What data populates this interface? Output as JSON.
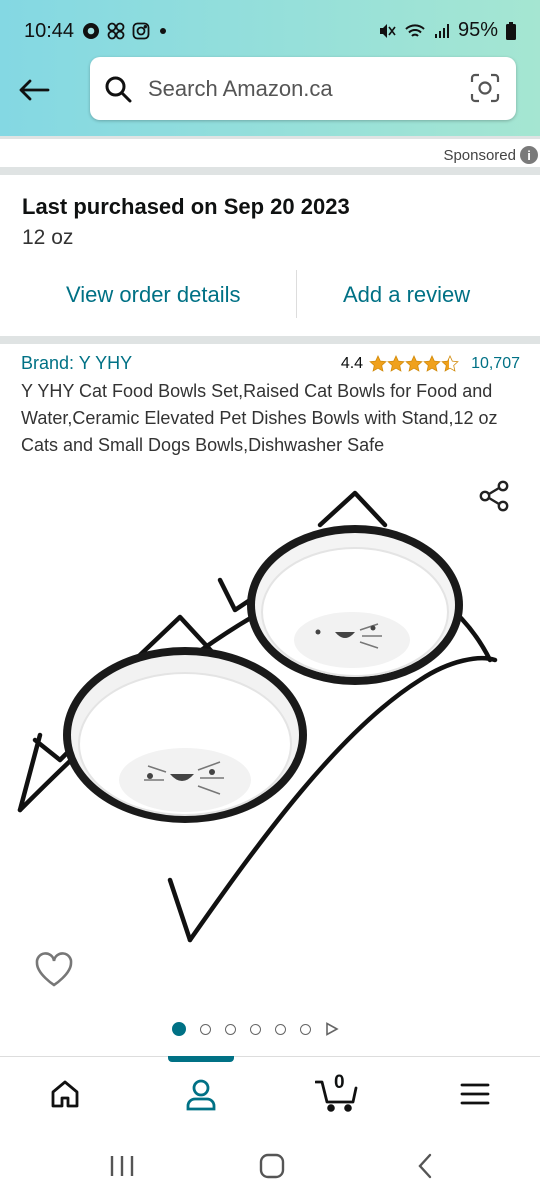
{
  "status_bar": {
    "time": "10:44",
    "battery": "95%"
  },
  "search": {
    "placeholder": "Search Amazon.ca"
  },
  "sponsored": "Sponsored",
  "purchase": {
    "last_purchased": "Last purchased on Sep 20 2023",
    "size": "12 oz",
    "view_order_details": "View order details",
    "add_review": "Add a review"
  },
  "product": {
    "brand": "Brand: Y YHY",
    "rating": "4.4",
    "stars": 4.4,
    "review_count": "10,707",
    "title": "Y YHY Cat Food Bowls Set,Raised Cat Bowls for Food and Water,Ceramic Elevated Pet Dishes Bowls with Stand,12 oz Cats and Small Dogs Bowls,Dishwasher Safe",
    "image_count": 6,
    "active_image": 1
  },
  "bottom_nav": {
    "items": [
      "home-icon",
      "account-icon",
      "cart-icon",
      "menu-icon"
    ],
    "cart_count": "0",
    "active": "account-icon"
  },
  "colors": {
    "accent": "#007185",
    "star": "#f0a11c",
    "header_start": "#84d8e3",
    "header_end": "#a5e6d2"
  }
}
